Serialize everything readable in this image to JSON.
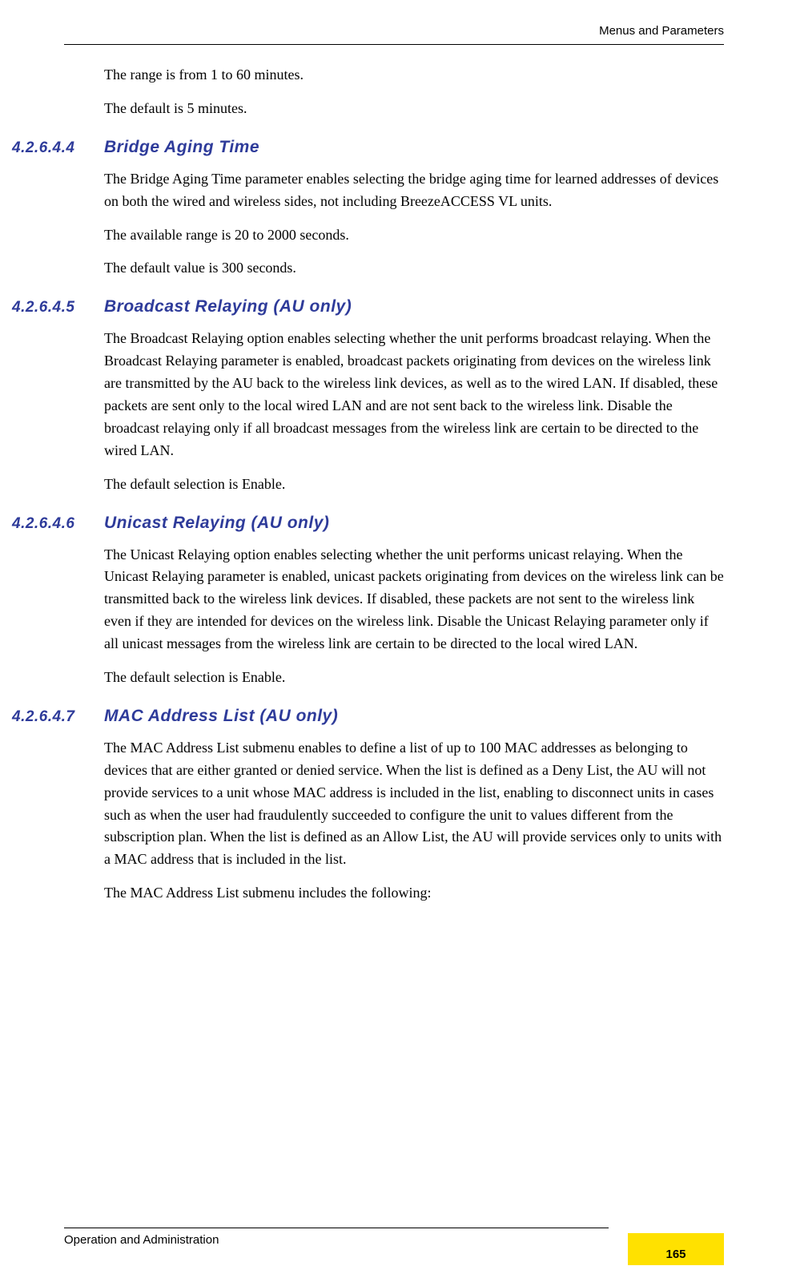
{
  "header": {
    "right": "Menus and Parameters"
  },
  "intro": {
    "p1": "The range is from 1 to 60 minutes.",
    "p2": "The default is 5 minutes."
  },
  "sections": [
    {
      "num": "4.2.6.4.4",
      "title": "Bridge Aging Time",
      "paras": [
        "The Bridge Aging Time parameter enables selecting the bridge aging time for learned addresses of devices on both the wired and wireless sides, not including BreezeACCESS VL units.",
        "The available range is 20 to 2000 seconds.",
        "The default value is 300 seconds."
      ]
    },
    {
      "num": "4.2.6.4.5",
      "title": "Broadcast Relaying (AU only)",
      "paras": [
        "The Broadcast Relaying option enables selecting whether the unit performs broadcast relaying. When the Broadcast Relaying parameter is enabled, broadcast packets originating from devices on the wireless link are transmitted by the AU back to the wireless link devices, as well as to the wired LAN. If disabled, these packets are sent only to the local wired LAN and are not sent back to the wireless link. Disable the broadcast relaying only if all broadcast messages from the wireless link are certain to be directed to the wired LAN.",
        "The default selection is Enable."
      ]
    },
    {
      "num": "4.2.6.4.6",
      "title": "Unicast Relaying (AU only)",
      "paras": [
        "The Unicast Relaying option enables selecting whether the unit performs unicast relaying. When the Unicast Relaying parameter is enabled, unicast packets originating from devices on the wireless link can be transmitted back to the wireless link devices. If disabled, these packets are not sent to the wireless link even if they are intended for devices on the wireless link. Disable the Unicast Relaying parameter only if all unicast messages from the wireless link are certain to be directed to the local wired LAN.",
        "The default selection is Enable."
      ]
    },
    {
      "num": "4.2.6.4.7",
      "title": "MAC Address List (AU only)",
      "paras": [
        "The MAC Address List submenu enables to define a list of up to 100 MAC addresses as belonging to devices that are either granted or denied service. When the list is defined as a Deny List, the AU will not provide services to a unit whose MAC address is included in the list, enabling to disconnect units in cases such as when the user had fraudulently succeeded to configure the unit to values different from the subscription plan. When the list is defined as an Allow List, the AU will provide services only to units with a MAC address that is included in the list.",
        "The MAC Address List submenu includes the following:"
      ]
    }
  ],
  "footer": {
    "left": "Operation and Administration",
    "page": "165"
  }
}
